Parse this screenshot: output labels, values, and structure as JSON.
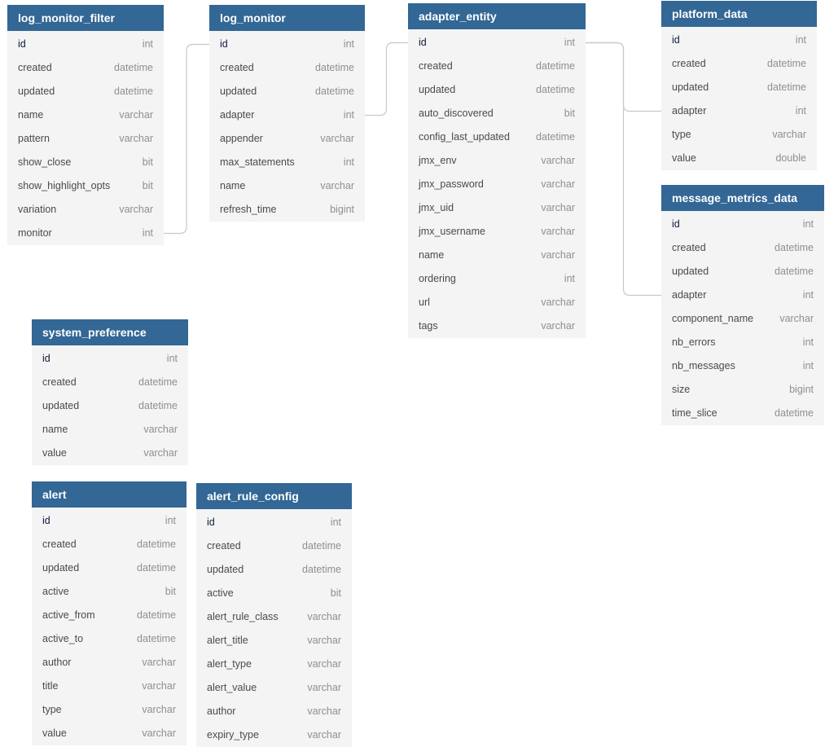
{
  "colors": {
    "header": "#336795",
    "body": "#f4f4f4",
    "connector": "#c8c8c8"
  },
  "tables": [
    {
      "name": "log_monitor_filter",
      "columns": [
        [
          "id",
          "int"
        ],
        [
          "created",
          "datetime"
        ],
        [
          "updated",
          "datetime"
        ],
        [
          "name",
          "varchar"
        ],
        [
          "pattern",
          "varchar"
        ],
        [
          "show_close",
          "bit"
        ],
        [
          "show_highlight_opts",
          "bit"
        ],
        [
          "variation",
          "varchar"
        ],
        [
          "monitor",
          "int"
        ]
      ]
    },
    {
      "name": "log_monitor",
      "columns": [
        [
          "id",
          "int"
        ],
        [
          "created",
          "datetime"
        ],
        [
          "updated",
          "datetime"
        ],
        [
          "adapter",
          "int"
        ],
        [
          "appender",
          "varchar"
        ],
        [
          "max_statements",
          "int"
        ],
        [
          "name",
          "varchar"
        ],
        [
          "refresh_time",
          "bigint"
        ]
      ]
    },
    {
      "name": "adapter_entity",
      "columns": [
        [
          "id",
          "int"
        ],
        [
          "created",
          "datetime"
        ],
        [
          "updated",
          "datetime"
        ],
        [
          "auto_discovered",
          "bit"
        ],
        [
          "config_last_updated",
          "datetime"
        ],
        [
          "jmx_env",
          "varchar"
        ],
        [
          "jmx_password",
          "varchar"
        ],
        [
          "jmx_uid",
          "varchar"
        ],
        [
          "jmx_username",
          "varchar"
        ],
        [
          "name",
          "varchar"
        ],
        [
          "ordering",
          "int"
        ],
        [
          "url",
          "varchar"
        ],
        [
          "tags",
          "varchar"
        ]
      ]
    },
    {
      "name": "platform_data",
      "columns": [
        [
          "id",
          "int"
        ],
        [
          "created",
          "datetime"
        ],
        [
          "updated",
          "datetime"
        ],
        [
          "adapter",
          "int"
        ],
        [
          "type",
          "varchar"
        ],
        [
          "value",
          "double"
        ]
      ]
    },
    {
      "name": "message_metrics_data",
      "columns": [
        [
          "id",
          "int"
        ],
        [
          "created",
          "datetime"
        ],
        [
          "updated",
          "datetime"
        ],
        [
          "adapter",
          "int"
        ],
        [
          "component_name",
          "varchar"
        ],
        [
          "nb_errors",
          "int"
        ],
        [
          "nb_messages",
          "int"
        ],
        [
          "size",
          "bigint"
        ],
        [
          "time_slice",
          "datetime"
        ]
      ]
    },
    {
      "name": "system_preference",
      "columns": [
        [
          "id",
          "int"
        ],
        [
          "created",
          "datetime"
        ],
        [
          "updated",
          "datetime"
        ],
        [
          "name",
          "varchar"
        ],
        [
          "value",
          "varchar"
        ]
      ]
    },
    {
      "name": "alert",
      "columns": [
        [
          "id",
          "int"
        ],
        [
          "created",
          "datetime"
        ],
        [
          "updated",
          "datetime"
        ],
        [
          "active",
          "bit"
        ],
        [
          "active_from",
          "datetime"
        ],
        [
          "active_to",
          "datetime"
        ],
        [
          "author",
          "varchar"
        ],
        [
          "title",
          "varchar"
        ],
        [
          "type",
          "varchar"
        ],
        [
          "value",
          "varchar"
        ]
      ]
    },
    {
      "name": "alert_rule_config",
      "columns": [
        [
          "id",
          "int"
        ],
        [
          "created",
          "datetime"
        ],
        [
          "updated",
          "datetime"
        ],
        [
          "active",
          "bit"
        ],
        [
          "alert_rule_class",
          "varchar"
        ],
        [
          "alert_title",
          "varchar"
        ],
        [
          "alert_type",
          "varchar"
        ],
        [
          "alert_value",
          "varchar"
        ],
        [
          "author",
          "varchar"
        ],
        [
          "expiry_type",
          "varchar"
        ]
      ]
    }
  ],
  "relations": [
    {
      "from": "log_monitor_filter.monitor",
      "to": "log_monitor.id"
    },
    {
      "from": "log_monitor.adapter",
      "to": "adapter_entity.id"
    },
    {
      "from": "platform_data.adapter",
      "to": "adapter_entity.id"
    },
    {
      "from": "message_metrics_data.adapter",
      "to": "adapter_entity.id"
    }
  ]
}
